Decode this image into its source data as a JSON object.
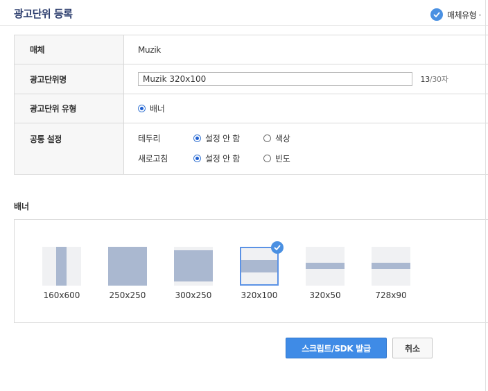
{
  "header": {
    "title": "광고단위 등록",
    "step_label": "매체유형 ·"
  },
  "form": {
    "media_label": "매체",
    "media_value": "Muzik",
    "name_label": "광고단위명",
    "name_value": "Muzik 320x100",
    "name_count": "13",
    "name_max": "/30자",
    "type_label": "광고단위 유형",
    "type_option": "배너",
    "common_label": "공통 설정",
    "border_label": "테두리",
    "border_option_none": "설정 안 함",
    "border_option_color": "색상",
    "refresh_label": "새로고침",
    "refresh_option_none": "설정 안 함",
    "refresh_option_freq": "빈도"
  },
  "banner": {
    "section_title": "배너",
    "sizes": [
      {
        "label": "160x600",
        "selected": false
      },
      {
        "label": "250x250",
        "selected": false
      },
      {
        "label": "300x250",
        "selected": false
      },
      {
        "label": "320x100",
        "selected": true
      },
      {
        "label": "320x50",
        "selected": false
      },
      {
        "label": "728x90",
        "selected": false
      }
    ]
  },
  "actions": {
    "issue_label": "스크립트/SDK 발급",
    "cancel_label": "취소"
  },
  "colors": {
    "accent": "#3f8be6",
    "thumb_fill": "#aab8d0",
    "thumb_bg": "#f0f1f3",
    "title": "#2d3e6e"
  }
}
